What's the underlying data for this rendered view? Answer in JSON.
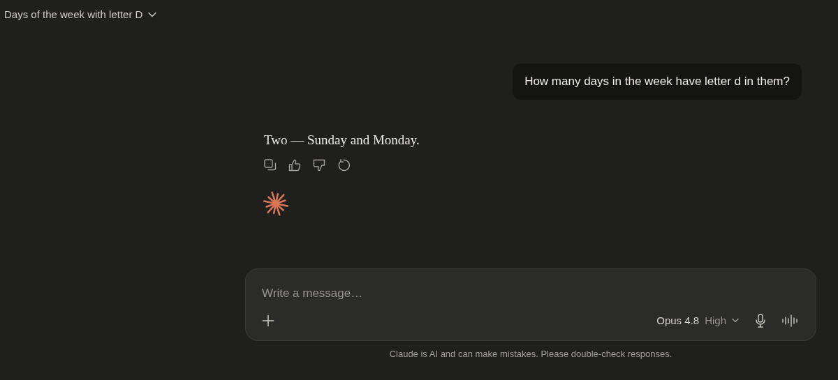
{
  "header": {
    "title": "Days of the week with letter D"
  },
  "messages": [
    {
      "kind": "user",
      "text": "How many days in the week have letter d in them?"
    },
    {
      "kind": "assistant",
      "text": "Two — Sunday and Monday."
    }
  ],
  "composer": {
    "placeholder": "Write a message…",
    "model": "Opus 4.8",
    "effort": "High"
  },
  "disclaimer": "Claude is AI and can make mistakes. Please double-check responses."
}
